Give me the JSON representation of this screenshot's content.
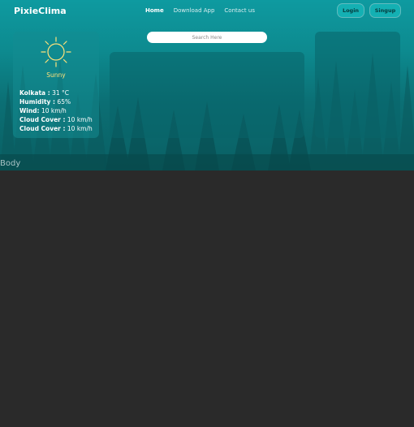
{
  "brand": {
    "name": "PixieClima"
  },
  "nav": {
    "items": [
      {
        "label": "Home",
        "active": true
      },
      {
        "label": "Download App",
        "active": false
      },
      {
        "label": "Contact us",
        "active": false
      }
    ]
  },
  "auth": {
    "login_label": "Login",
    "signup_label": "Singup"
  },
  "search": {
    "placeholder": "Search Here"
  },
  "weather": {
    "icon": "sun-icon",
    "condition": "Sunny",
    "stats": [
      {
        "label": "Kolkata :",
        "value": "31 °C"
      },
      {
        "label": "Humidity :",
        "value": "65%"
      },
      {
        "label": "Wind:",
        "value": "10 km/h"
      },
      {
        "label": "Cloud Cover :",
        "value": "10 km/h"
      },
      {
        "label": "Cloud Cover :",
        "value": "10 km/h"
      }
    ]
  },
  "section": {
    "label": "Body"
  },
  "colors": {
    "accent": "#14b0b3",
    "sun": "#ffe27a",
    "background": "#2a2a2a"
  }
}
